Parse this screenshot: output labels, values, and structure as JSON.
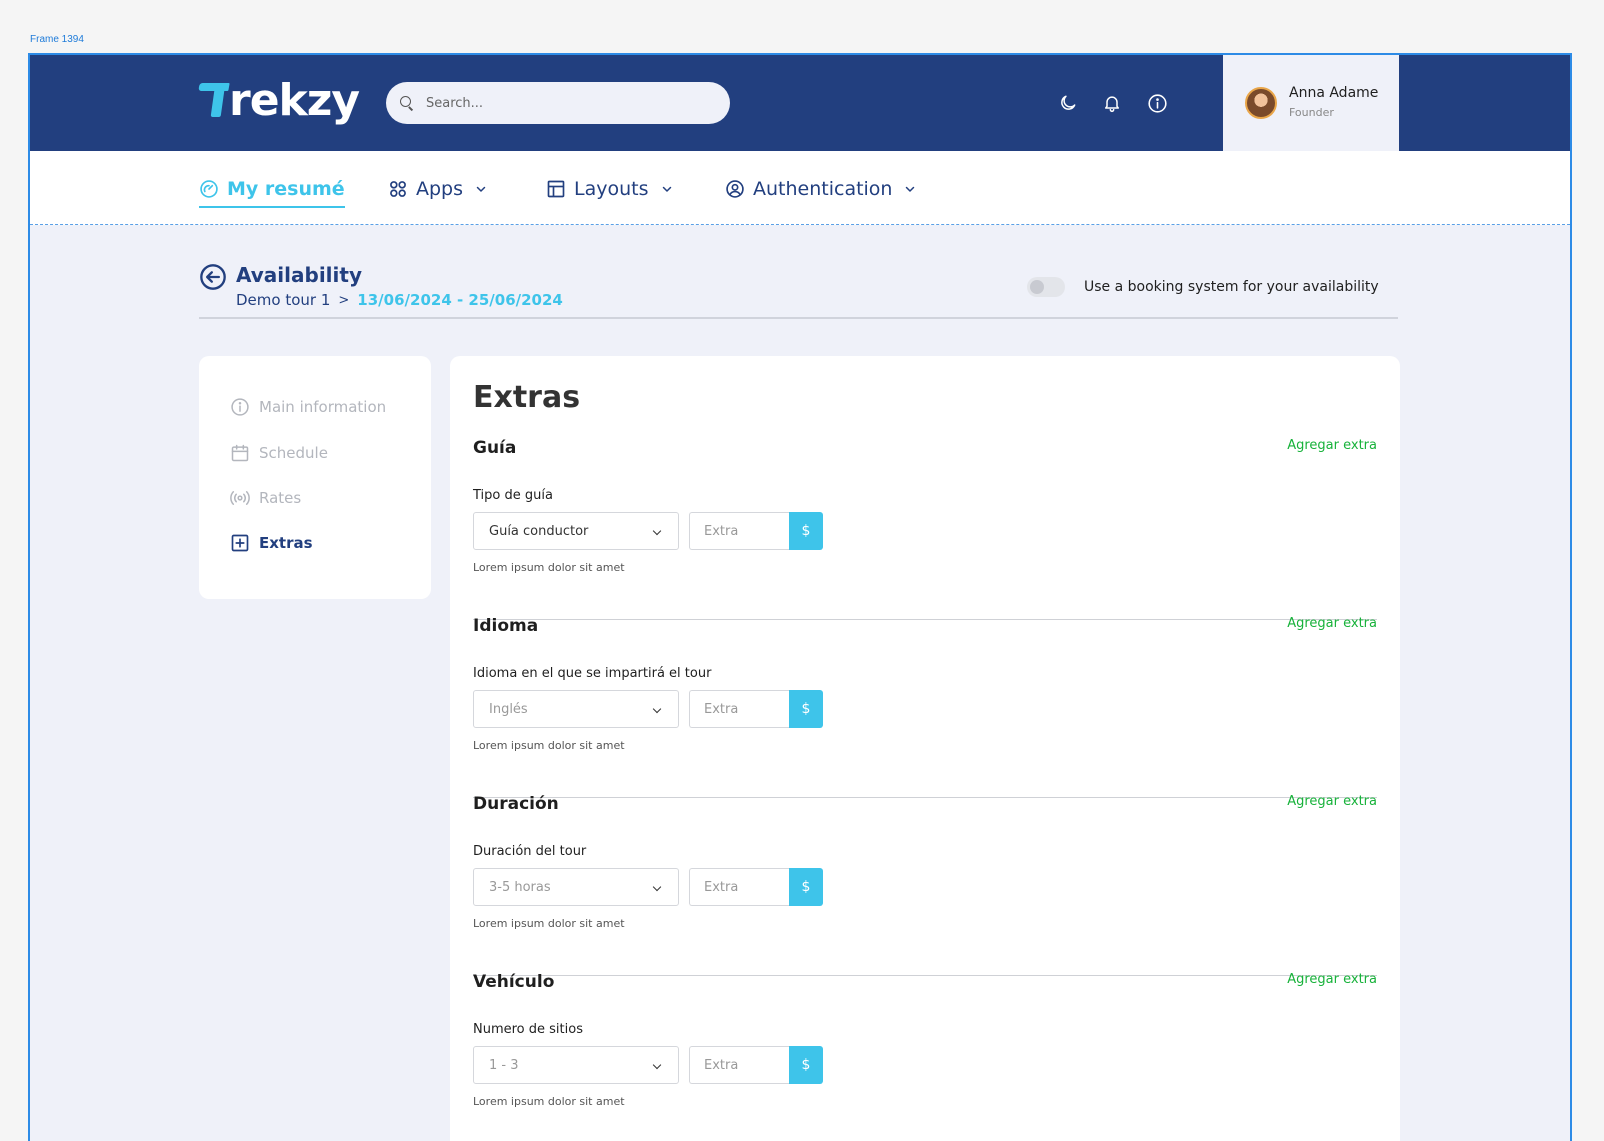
{
  "frame_label": "Frame 1394",
  "colors": {
    "brand_dark": "#223f7f",
    "accent": "#3ec4ea",
    "success": "#17b23a",
    "page_bg": "#eff1f9"
  },
  "header": {
    "logo_text": "rekzy",
    "search": {
      "placeholder": "Search..."
    },
    "icons": [
      "moon-icon",
      "bell-icon",
      "info-icon"
    ],
    "user": {
      "name": "Anna Adame",
      "role": "Founder"
    }
  },
  "nav": {
    "items": [
      {
        "label": "My resumé",
        "icon": "speedometer-icon",
        "active": true
      },
      {
        "label": "Apps",
        "icon": "grid-icon",
        "dropdown": true
      },
      {
        "label": "Layouts",
        "icon": "layout-icon",
        "dropdown": true
      },
      {
        "label": "Authentication",
        "icon": "user-circle-icon",
        "dropdown": true
      }
    ]
  },
  "page": {
    "title": "Availability",
    "breadcrumb": {
      "tour": "Demo tour 1",
      "separator": ">",
      "dates": "13/06/2024 - 25/06/2024"
    },
    "toggle_label": "Use a booking system for your availability",
    "toggle_on": false
  },
  "sidebar": {
    "items": [
      {
        "label": "Main information",
        "icon": "info-icon",
        "active": false
      },
      {
        "label": "Schedule",
        "icon": "calendar-icon",
        "active": false
      },
      {
        "label": "Rates",
        "icon": "broadcast-icon",
        "active": false
      },
      {
        "label": "Extras",
        "icon": "plus-square-icon",
        "active": true
      }
    ]
  },
  "main": {
    "title": "Extras",
    "sections": [
      {
        "title": "Guía",
        "add_label": "Agregar extra",
        "field_label": "Tipo de guía",
        "select_value": "Guía conductor",
        "extra_placeholder": "Extra",
        "currency": "$",
        "hint": "Lorem ipsum dolor sit amet"
      },
      {
        "title": "Idioma",
        "add_label": "Agregar extra",
        "field_label": "Idioma en el que se impartirá el tour",
        "select_value": "Inglés",
        "extra_placeholder": "Extra",
        "currency": "$",
        "hint": "Lorem ipsum dolor sit amet"
      },
      {
        "title": "Duración",
        "add_label": "Agregar extra",
        "field_label": "Duración del tour",
        "select_value": "3-5 horas",
        "extra_placeholder": "Extra",
        "currency": "$",
        "hint": "Lorem ipsum dolor sit amet"
      },
      {
        "title": "Vehículo",
        "add_label": "Agregar extra",
        "field_label": "Numero de sitios",
        "select_value": "1 - 3",
        "extra_placeholder": "Extra",
        "currency": "$",
        "hint": "Lorem ipsum dolor sit amet"
      }
    ]
  }
}
